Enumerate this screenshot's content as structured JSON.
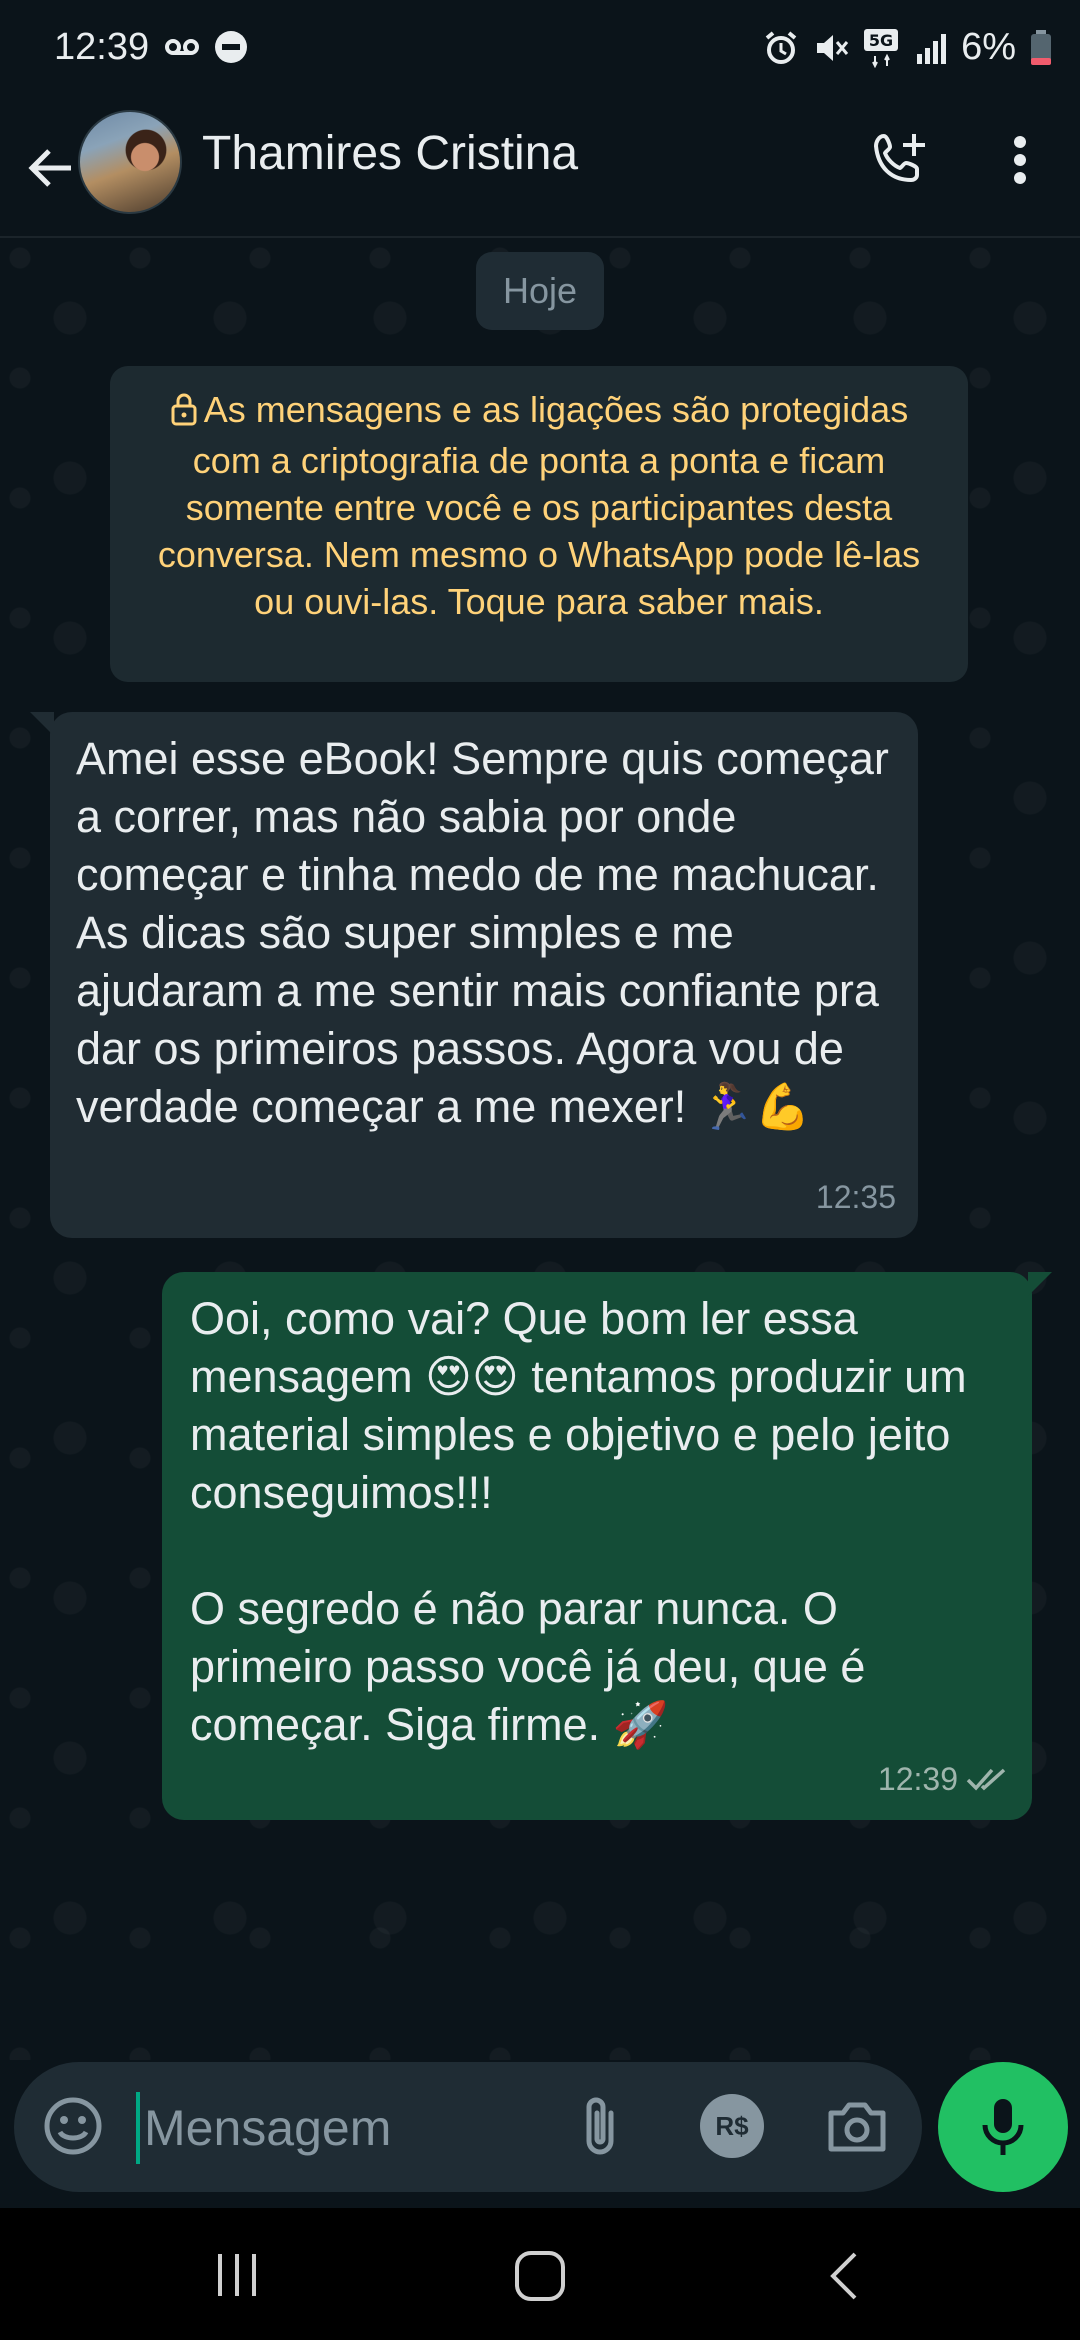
{
  "status_bar": {
    "time": "12:39",
    "battery": "6%",
    "network": "5G",
    "left_icons": [
      "voicemail-icon",
      "do-not-disturb-icon"
    ],
    "right_icons": [
      "alarm-icon",
      "mute-icon",
      "5g-icon",
      "signal-icon",
      "battery-icon"
    ]
  },
  "header": {
    "contact_name": "Thamires Cristina",
    "icons": [
      "back-arrow-icon",
      "avatar",
      "add-call-icon",
      "more-vertical-icon"
    ]
  },
  "chat": {
    "date_chip": "Hoje",
    "system_notice": "As mensagens e as ligações são protegidas com a criptografia de ponta a ponta e ficam somente entre você e os participantes desta conversa. Nem mesmo o WhatsApp pode lê-las ou ouvi-las. Toque para saber mais.",
    "messages": [
      {
        "direction": "incoming",
        "text": "Amei esse eBook! Sempre quis começar a correr, mas não sabia por onde começar e tinha medo de me machucar. As dicas são super simples e me ajudaram a me sentir mais confiante pra dar os primeiros passos. Agora vou de verdade começar a me mexer! 🏃‍♀️💪",
        "time": "12:35"
      },
      {
        "direction": "outgoing",
        "text": "Ooi, como vai? Que bom ler essa mensagem 😍😍 tentamos produzir um material simples e objetivo e pelo jeito conseguimos!!!\n\nO segredo é não parar nunca. O primeiro passo você já deu, que é começar. Siga firme. 🚀",
        "time": "12:39",
        "status": "read"
      }
    ]
  },
  "input_bar": {
    "placeholder": "Mensagem",
    "value": "",
    "payment_label": "R$"
  },
  "colors": {
    "background": "#0b141a",
    "incoming_bubble": "#202c33",
    "outgoing_bubble": "#144d37",
    "accent": "#21c063",
    "notice_text": "#ffd279"
  }
}
